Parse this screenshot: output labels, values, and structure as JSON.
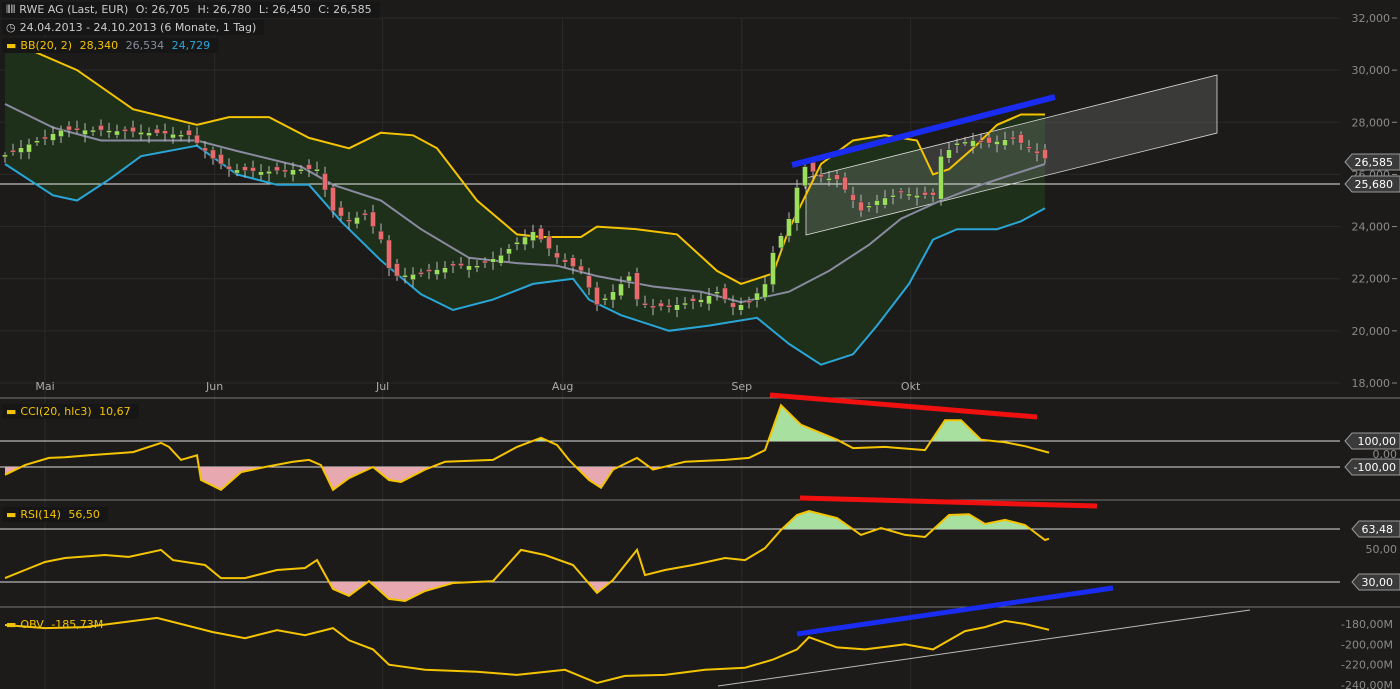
{
  "header": {
    "title": "RWE AG (Last, EUR)",
    "open": "O: 26,705",
    "high": "H: 26,780",
    "low": "L: 26,450",
    "close": "C: 26,585",
    "range": "24.04.2013 - 24.10.2013 (6 Monate, 1 Tag)"
  },
  "legends": {
    "bb": "BB(20, 2)",
    "bb_upper": "28,340",
    "bb_mid": "26,534",
    "bb_lower": "24,729",
    "cci": "CCI(20, hlc3)",
    "cci_val": "10,67",
    "rsi": "RSI(14)",
    "rsi_val": "56,50",
    "obv": "OBV",
    "obv_val": "-185,73M"
  },
  "tags": {
    "last": "26,585",
    "hline": "25,680",
    "cci_hi": "100,00",
    "cci_lo": "-100,00",
    "rsi_hi": "63,48",
    "rsi_lo": "30,00"
  },
  "colors": {
    "up": "#9be05a",
    "down": "#e86a6a",
    "bb_upper": "#f5c400",
    "bb_mid": "#8a8aa0",
    "bb_lower": "#2aa6d6",
    "indicator": "#f5c400",
    "fill_up": "#a8e0a0",
    "fill_down": "#e8a8b0"
  },
  "chart_data": {
    "type": "candlestick",
    "x_unit": "trading day index from 24.04.2013",
    "months": [
      {
        "label": "Mai",
        "day": 5
      },
      {
        "label": "Jun",
        "day": 26.2
      },
      {
        "label": "Jul",
        "day": 47.2
      },
      {
        "label": "Aug",
        "day": 69.7
      },
      {
        "label": "Sep",
        "day": 92.1
      },
      {
        "label": "Okt",
        "day": 113.2
      }
    ],
    "price": {
      "ylim": [
        18000,
        32000
      ],
      "ticks": [
        "32,000",
        "30,000",
        "28,000",
        "26,000",
        "24,000",
        "22,000",
        "20,000",
        "18,000"
      ],
      "tick_values": [
        32,
        30,
        28,
        26,
        24,
        22,
        20,
        18
      ],
      "close": [
        [
          0,
          26.75
        ],
        [
          7,
          27.7
        ],
        [
          12,
          27.7
        ],
        [
          18,
          27.6
        ],
        [
          23,
          27.5
        ],
        [
          26,
          26.6
        ],
        [
          28,
          26.2
        ],
        [
          32,
          26.1
        ],
        [
          37,
          26.2
        ],
        [
          39,
          26.2
        ],
        [
          41,
          24.6
        ],
        [
          43,
          24.2
        ],
        [
          45,
          24.5
        ],
        [
          47,
          23.5
        ],
        [
          48,
          22.4
        ],
        [
          49,
          22.1
        ],
        [
          52,
          22.2
        ],
        [
          56,
          22.5
        ],
        [
          59,
          22.5
        ],
        [
          62,
          22.9
        ],
        [
          64,
          23.4
        ],
        [
          66,
          23.8
        ],
        [
          67,
          23.5
        ],
        [
          69,
          22.8
        ],
        [
          72,
          22.3
        ],
        [
          74,
          21.0
        ],
        [
          76,
          21.5
        ],
        [
          78,
          22.1
        ],
        [
          79,
          21.2
        ],
        [
          81,
          20.9
        ],
        [
          84,
          21.0
        ],
        [
          87,
          21.2
        ],
        [
          89,
          21.5
        ],
        [
          91,
          20.9
        ],
        [
          93,
          21.1
        ],
        [
          95,
          21.8
        ],
        [
          96,
          23.0
        ],
        [
          98,
          24.3
        ],
        [
          99,
          25.5
        ],
        [
          100,
          26.3
        ],
        [
          102,
          25.9
        ],
        [
          104,
          25.8
        ],
        [
          107,
          24.6
        ],
        [
          109,
          25.0
        ],
        [
          112,
          25.3
        ],
        [
          114,
          25.2
        ],
        [
          116,
          25.2
        ],
        [
          117,
          26.7
        ],
        [
          119,
          27.2
        ],
        [
          121,
          27.3
        ],
        [
          123,
          27.2
        ],
        [
          126,
          27.4
        ],
        [
          128,
          27.0
        ],
        [
          130,
          26.6
        ]
      ],
      "bb_upper": [
        [
          0,
          31.2
        ],
        [
          9,
          30.0
        ],
        [
          16,
          28.5
        ],
        [
          24,
          27.9
        ],
        [
          28,
          28.2
        ],
        [
          33,
          28.2
        ],
        [
          38,
          27.4
        ],
        [
          43,
          27.0
        ],
        [
          47,
          27.6
        ],
        [
          51,
          27.5
        ],
        [
          54,
          27.0
        ],
        [
          59,
          25.0
        ],
        [
          64,
          23.7
        ],
        [
          67,
          23.6
        ],
        [
          72,
          23.6
        ],
        [
          74,
          24.0
        ],
        [
          79,
          23.9
        ],
        [
          84,
          23.7
        ],
        [
          89,
          22.3
        ],
        [
          92,
          21.8
        ],
        [
          96,
          22.2
        ],
        [
          98,
          23.9
        ],
        [
          102,
          26.4
        ],
        [
          106,
          27.3
        ],
        [
          110,
          27.5
        ],
        [
          114,
          27.3
        ],
        [
          116,
          26.0
        ],
        [
          118,
          26.2
        ],
        [
          121,
          27.0
        ],
        [
          124,
          27.9
        ],
        [
          127,
          28.3
        ],
        [
          130,
          28.3
        ]
      ],
      "bb_mid": [
        [
          0,
          28.7
        ],
        [
          6,
          27.8
        ],
        [
          12,
          27.3
        ],
        [
          24,
          27.3
        ],
        [
          29,
          26.9
        ],
        [
          37,
          26.3
        ],
        [
          41,
          25.6
        ],
        [
          47,
          25.0
        ],
        [
          52,
          23.9
        ],
        [
          58,
          22.8
        ],
        [
          64,
          22.6
        ],
        [
          69,
          22.5
        ],
        [
          74,
          22.1
        ],
        [
          81,
          21.7
        ],
        [
          87,
          21.5
        ],
        [
          92,
          21.1
        ],
        [
          98,
          21.5
        ],
        [
          103,
          22.3
        ],
        [
          108,
          23.3
        ],
        [
          112,
          24.3
        ],
        [
          117,
          25.0
        ],
        [
          122,
          25.6
        ],
        [
          127,
          26.1
        ],
        [
          130,
          26.4
        ]
      ],
      "bb_lower": [
        [
          0,
          26.4
        ],
        [
          6,
          25.2
        ],
        [
          9,
          25.0
        ],
        [
          13,
          25.8
        ],
        [
          17,
          26.7
        ],
        [
          24,
          27.1
        ],
        [
          29,
          26.0
        ],
        [
          34,
          25.6
        ],
        [
          38,
          25.6
        ],
        [
          42,
          24.2
        ],
        [
          47,
          22.7
        ],
        [
          52,
          21.4
        ],
        [
          56,
          20.8
        ],
        [
          61,
          21.2
        ],
        [
          66,
          21.8
        ],
        [
          71,
          22.0
        ],
        [
          73,
          21.2
        ],
        [
          77,
          20.6
        ],
        [
          83,
          20.0
        ],
        [
          88,
          20.2
        ],
        [
          94,
          20.5
        ],
        [
          98,
          19.5
        ],
        [
          102,
          18.7
        ],
        [
          106,
          19.1
        ],
        [
          109,
          20.2
        ],
        [
          113,
          21.8
        ],
        [
          116,
          23.5
        ],
        [
          119,
          23.9
        ],
        [
          124,
          23.9
        ],
        [
          127,
          24.2
        ],
        [
          130,
          24.7
        ]
      ]
    },
    "cci": {
      "levels": [
        100,
        0,
        -100
      ],
      "tick": "0,00",
      "values": [
        [
          0,
          -160
        ],
        [
          2.5,
          -85
        ],
        [
          5.5,
          -30
        ],
        [
          7.5,
          -25
        ],
        [
          10.5,
          -10
        ],
        [
          16,
          15
        ],
        [
          19.5,
          85
        ],
        [
          20.5,
          55
        ],
        [
          22,
          -45
        ],
        [
          24,
          -10
        ],
        [
          24.5,
          -200
        ],
        [
          27,
          -275
        ],
        [
          29.5,
          -140
        ],
        [
          32.5,
          -100
        ],
        [
          36,
          -60
        ],
        [
          38,
          -45
        ],
        [
          39.5,
          -85
        ],
        [
          41,
          -275
        ],
        [
          43,
          -185
        ],
        [
          46,
          -100
        ],
        [
          48,
          -200
        ],
        [
          49.5,
          -215
        ],
        [
          52.5,
          -120
        ],
        [
          55,
          -60
        ],
        [
          61,
          -45
        ],
        [
          64,
          55
        ],
        [
          67,
          125
        ],
        [
          69,
          70
        ],
        [
          70.5,
          -45
        ],
        [
          73,
          -200
        ],
        [
          74.5,
          -260
        ],
        [
          76,
          -120
        ],
        [
          79,
          -30
        ],
        [
          81,
          -120
        ],
        [
          85,
          -60
        ],
        [
          90,
          -45
        ],
        [
          93,
          -30
        ],
        [
          95,
          30
        ],
        [
          97,
          375
        ],
        [
          99.5,
          225
        ],
        [
          104,
          110
        ],
        [
          106,
          45
        ],
        [
          110,
          55
        ],
        [
          115,
          30
        ],
        [
          117.5,
          260
        ],
        [
          119.5,
          260
        ],
        [
          122,
          110
        ],
        [
          125,
          90
        ],
        [
          127.5,
          60
        ],
        [
          130.5,
          10.67
        ]
      ]
    },
    "rsi": {
      "levels": [
        63.48,
        30
      ],
      "tick": "50,00",
      "values": [
        [
          0,
          31.6
        ],
        [
          2.5,
          36.7
        ],
        [
          5,
          41.8
        ],
        [
          7.5,
          44.3
        ],
        [
          12.5,
          46.2
        ],
        [
          15.5,
          45
        ],
        [
          19.5,
          49.4
        ],
        [
          21,
          43
        ],
        [
          25,
          39.9
        ],
        [
          27,
          31.6
        ],
        [
          30,
          31.6
        ],
        [
          34,
          36.7
        ],
        [
          37.5,
          38
        ],
        [
          39,
          43
        ],
        [
          41,
          24.7
        ],
        [
          43,
          20.3
        ],
        [
          45.5,
          29.7
        ],
        [
          48,
          18.4
        ],
        [
          50,
          17.1
        ],
        [
          52.5,
          23.4
        ],
        [
          56,
          28.5
        ],
        [
          61,
          29.7
        ],
        [
          64.5,
          49.4
        ],
        [
          67.5,
          46.2
        ],
        [
          71,
          39.9
        ],
        [
          74,
          22.2
        ],
        [
          76,
          30.4
        ],
        [
          79,
          49.4
        ],
        [
          80,
          33.5
        ],
        [
          82.5,
          36.7
        ],
        [
          86,
          39.9
        ],
        [
          90,
          44.3
        ],
        [
          92.5,
          43
        ],
        [
          95,
          50.6
        ],
        [
          97,
          62
        ],
        [
          99,
          71.5
        ],
        [
          100.5,
          74
        ],
        [
          104,
          69.6
        ],
        [
          107,
          58.9
        ],
        [
          109.5,
          63.3
        ],
        [
          112.5,
          58.9
        ],
        [
          115,
          57.6
        ],
        [
          118,
          71.5
        ],
        [
          120.5,
          72
        ],
        [
          122.5,
          65.8
        ],
        [
          125,
          68.4
        ],
        [
          127.5,
          65.2
        ],
        [
          130,
          55.7
        ],
        [
          130.5,
          56.5
        ]
      ]
    },
    "obv": {
      "unit": "M",
      "ticks": [
        "-180,00M",
        "-200,00M",
        "-220,00M",
        "-240,00M"
      ],
      "tick_values": [
        -180,
        -200,
        -220,
        -240
      ],
      "values": [
        [
          0,
          -181
        ],
        [
          5,
          -184
        ],
        [
          10,
          -183
        ],
        [
          15,
          -178
        ],
        [
          19,
          -174
        ],
        [
          22.5,
          -181
        ],
        [
          26,
          -188
        ],
        [
          30,
          -194
        ],
        [
          34,
          -186
        ],
        [
          37.5,
          -191
        ],
        [
          41,
          -184
        ],
        [
          43,
          -196
        ],
        [
          46,
          -205
        ],
        [
          48,
          -220
        ],
        [
          52.5,
          -225
        ],
        [
          59,
          -227
        ],
        [
          64,
          -230
        ],
        [
          70,
          -225
        ],
        [
          74,
          -238
        ],
        [
          77.5,
          -231
        ],
        [
          82.5,
          -230
        ],
        [
          87.5,
          -225
        ],
        [
          92.5,
          -223
        ],
        [
          96,
          -215
        ],
        [
          99,
          -205
        ],
        [
          100.5,
          -193
        ],
        [
          104,
          -203
        ],
        [
          107.5,
          -205
        ],
        [
          112.5,
          -200
        ],
        [
          116,
          -205
        ],
        [
          120,
          -187
        ],
        [
          122.5,
          -183
        ],
        [
          125,
          -177
        ],
        [
          127.5,
          -180
        ],
        [
          130.5,
          -185.73
        ]
      ]
    }
  }
}
